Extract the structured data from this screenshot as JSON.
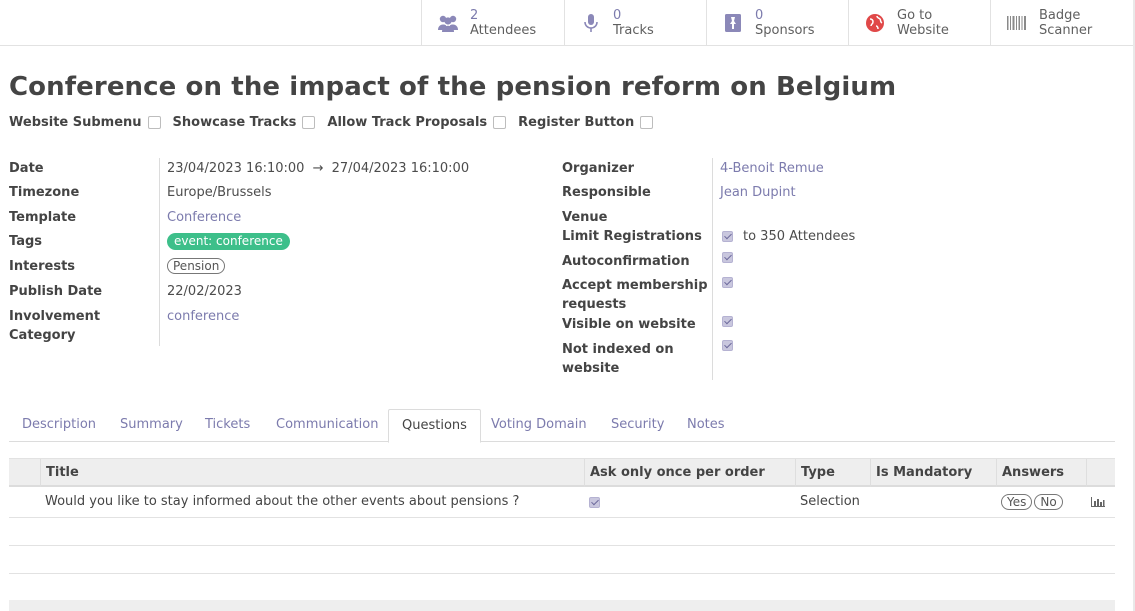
{
  "smart_buttons": [
    {
      "number": "2",
      "label": "Attendees",
      "icon": "users-icon"
    },
    {
      "number": "0",
      "label": "Tracks",
      "icon": "microphone-icon"
    },
    {
      "number": "0",
      "label": "Sponsors",
      "icon": "sponsor-badge-icon"
    },
    {
      "line1": "Go to",
      "line2": "Website",
      "icon": "globe-icon"
    },
    {
      "line1": "Badge",
      "line2": "Scanner",
      "icon": "barcode-icon"
    }
  ],
  "title": "Conference on the impact of the pension reform on Belgium",
  "flags": [
    {
      "label": "Website Submenu",
      "checked": false
    },
    {
      "label": "Showcase Tracks",
      "checked": false
    },
    {
      "label": "Allow Track Proposals",
      "checked": false
    },
    {
      "label": "Register Button",
      "checked": false
    }
  ],
  "left_fields": {
    "date_label": "Date",
    "date_start": "23/04/2023 16:10:00",
    "date_arrow": "→",
    "date_end": "27/04/2023 16:10:00",
    "timezone_label": "Timezone",
    "timezone": "Europe/Brussels",
    "template_label": "Template",
    "template": "Conference",
    "tags_label": "Tags",
    "tag": "event: conference",
    "interests_label": "Interests",
    "interest": "Pension",
    "publish_label": "Publish Date",
    "publish_date": "22/02/2023",
    "involvement_label_1": "Involvement",
    "involvement_label_2": "Category",
    "involvement": "conference"
  },
  "right_fields": {
    "organizer_label": "Organizer",
    "organizer": "4-Benoit Remue",
    "responsible_label": "Responsible",
    "responsible": "Jean Dupint",
    "venue_label": "Venue",
    "limit_label": "Limit Registrations",
    "limit_text": "to 350 Attendees",
    "autoconfirm_label": "Autoconfirmation",
    "membership_label_1": "Accept membership",
    "membership_label_2": "requests",
    "visible_label": "Visible on website",
    "not_indexed_label_1": "Not indexed on",
    "not_indexed_label_2": "website"
  },
  "tabs": [
    "Description",
    "Summary",
    "Tickets",
    "Communication",
    "Questions",
    "Voting Domain",
    "Security",
    "Notes"
  ],
  "active_tab": "Questions",
  "table": {
    "headers": [
      "Title",
      "Ask only once per order",
      "Type",
      "Is Mandatory",
      "Answers"
    ],
    "rows": [
      {
        "title": "Would you like to stay informed about the other events about pensions ?",
        "ask_once": true,
        "type": "Selection",
        "is_mandatory": "",
        "answers": [
          "Yes",
          "No"
        ]
      }
    ]
  },
  "colors": {
    "link": "#7c7bad",
    "tag_green": "#3dbf8a",
    "globe_red": "#e04848"
  }
}
